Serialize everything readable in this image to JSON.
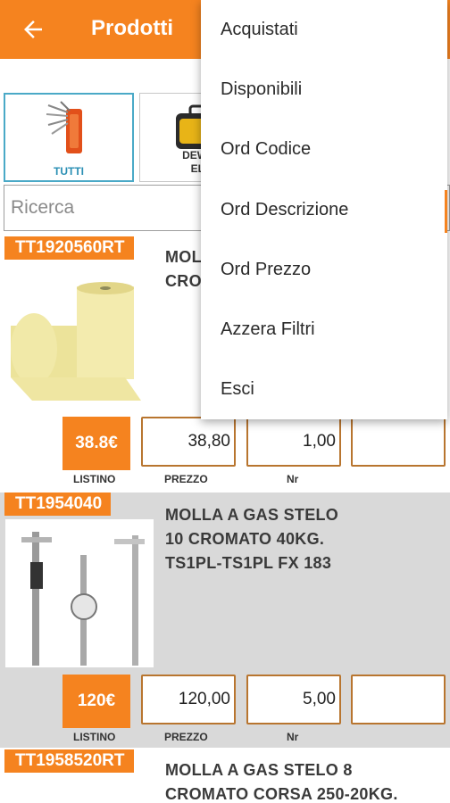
{
  "header": {
    "title": "Prodotti"
  },
  "categories": [
    {
      "label": "TUTTI",
      "active": true
    },
    {
      "label": "DEWALT UTENSILI ELETTRICI",
      "label_line1": "DEWALT",
      "label_line2": "ELET",
      "active": false
    }
  ],
  "search": {
    "placeholder": "Ricerca",
    "value": ""
  },
  "products": [
    {
      "code": "TT1920560RT",
      "description_line1": "MOL",
      "description_line2": "CRO",
      "listino": "38.8€",
      "prezzo": "38,80",
      "nr": "1,00",
      "extra": "",
      "labels": {
        "listino": "LISTINO",
        "prezzo": "PREZZO",
        "nr": "Nr"
      }
    },
    {
      "code": "TT1954040",
      "description_line1": "MOLLA A GAS STELO",
      "description_line2": "10 CROMATO 40KG.",
      "description_line3": "TS1PL-TS1PL FX 183",
      "listino": "120€",
      "prezzo": "120,00",
      "nr": "5,00",
      "extra": "",
      "labels": {
        "listino": "LISTINO",
        "prezzo": "PREZZO",
        "nr": "Nr"
      }
    },
    {
      "code": "TT1958520RT",
      "description_line1": "MOLLA A GAS STELO 8",
      "description_line2": "CROMATO CORSA 250-20KG."
    }
  ],
  "menu": {
    "items": [
      "Acquistati",
      "Disponibili",
      "Ord Codice",
      "Ord Descrizione",
      "Ord Prezzo",
      "Azzera Filtri",
      "Esci"
    ]
  },
  "colors": {
    "accent": "#f5831f",
    "active_border": "#4aa9c7",
    "price_row_bg": "#d9d9d9",
    "field_border": "#b8752f"
  },
  "icons": [
    "arrow-left-icon"
  ]
}
